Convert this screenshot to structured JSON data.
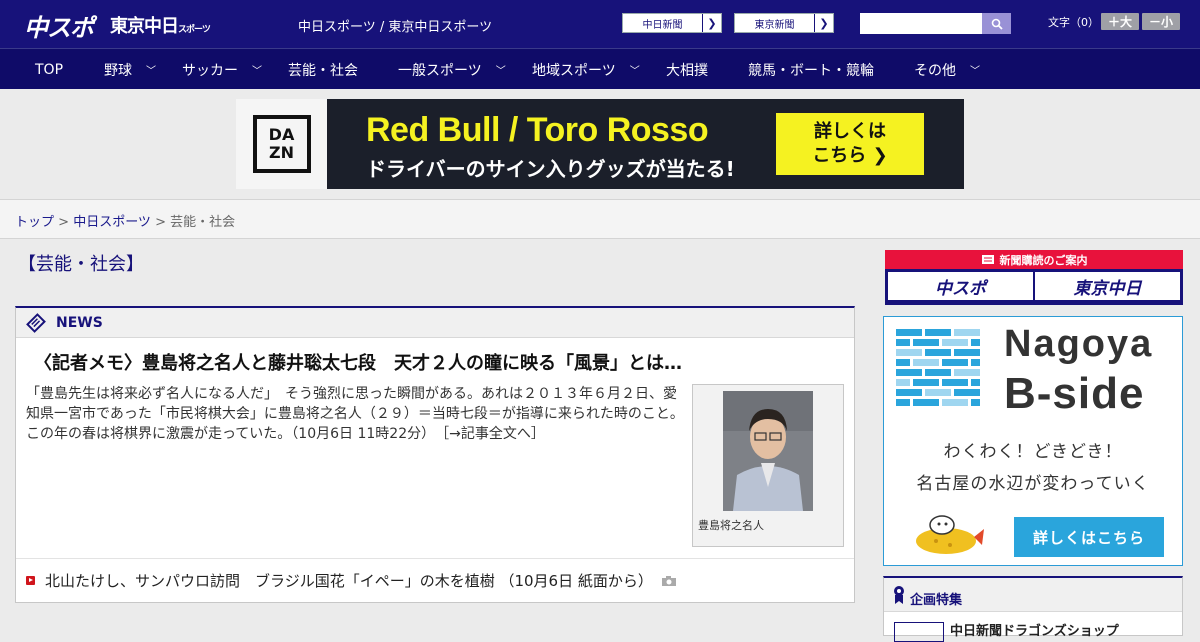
{
  "header": {
    "logo_chunichi": "中スポ",
    "logo_tokyo": "東京中日",
    "logo_tokyo_small": "スポーツ",
    "site_links": "中日スポーツ / 東京中日スポーツ",
    "paper_buttons": [
      "中日新聞",
      "東京新聞"
    ],
    "search_placeholder": "",
    "font_size_label": "文字（0）",
    "font_larger": "＋大",
    "font_smaller": "－小"
  },
  "nav": {
    "items": [
      {
        "label": "TOP",
        "has_menu": false
      },
      {
        "label": "野球",
        "has_menu": true
      },
      {
        "label": "サッカー",
        "has_menu": true
      },
      {
        "label": "芸能・社会",
        "has_menu": false
      },
      {
        "label": "一般スポーツ",
        "has_menu": true
      },
      {
        "label": "地域スポーツ",
        "has_menu": true
      },
      {
        "label": "大相撲",
        "has_menu": false
      },
      {
        "label": "競馬・ボート・競輪",
        "has_menu": false
      },
      {
        "label": "その他",
        "has_menu": true
      }
    ]
  },
  "ad": {
    "brand_line1": "DA",
    "brand_line2": "ZN",
    "title": "Red Bull / Toro Rosso",
    "subtitle": "ドライバーのサイン入りグッズが当たる!",
    "cta_line1": "詳しくは",
    "cta_line2": "こちら ❯"
  },
  "breadcrumb": {
    "top": "トップ",
    "section": "中日スポーツ",
    "current": "芸能・社会",
    "sep": " > "
  },
  "page": {
    "title": "【芸能・社会】"
  },
  "news": {
    "heading": "NEWS",
    "headline": "〈記者メモ〉豊島将之名人と藤井聡太七段　天才２人の瞳に映る「風景」とは…",
    "body": "「豊島先生は将来必ず名人になる人だ」　そう強烈に思った瞬間がある。あれは２０１３年６月２日、愛知県一宮市であった「市民将棋大会」に豊島将之名人（２９）＝当時七段＝が指導に来られた時のこと。この年の春は将棋界に激震が走っていた。（10月6日 11時22分）　［→記事全文へ］",
    "photo_caption": "豊島将之名人",
    "sub_item": "北山たけし、サンパウロ訪問　ブラジル国花「イペー」の木を植樹 （10月6日 紙面から）"
  },
  "sidebar": {
    "subscription_bar": "新聞購読のご案内",
    "subscription_left": "中スポ",
    "subscription_right": "東京中日",
    "bside_title1": "Nagoya",
    "bside_title2": "B-side",
    "bside_copy1": "わくわく！どきどき！",
    "bside_copy2": "名古屋の水辺が変わっていく",
    "bside_button": "詳しくはこちら",
    "special_heading": "企画特集",
    "special_item": "中日新聞ドラゴンズショップ"
  },
  "colors": {
    "header_bg": "#17127a",
    "nav_bg": "#0f0b68",
    "accent_red": "#d0151c",
    "ad_yellow": "#f5f221",
    "bside_blue": "#2aa5dc"
  }
}
